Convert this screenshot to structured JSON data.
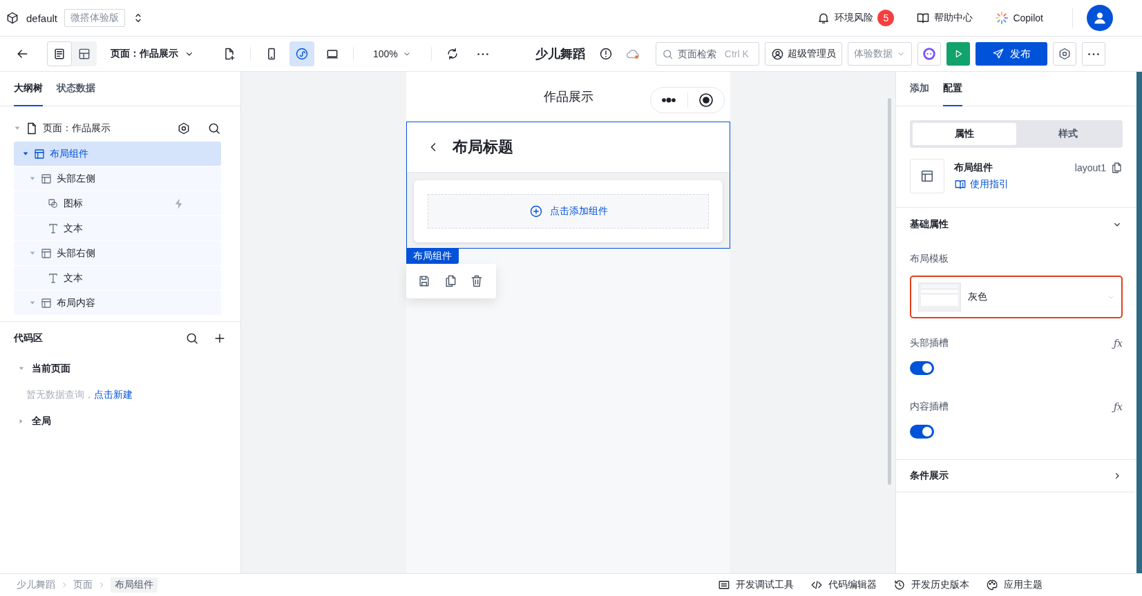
{
  "app_bar": {
    "workspace": "default",
    "edition": "微搭体验版",
    "risk": {
      "label": "环境风险",
      "count": "5"
    },
    "help": "帮助中心",
    "copilot": "Copilot"
  },
  "toolbar": {
    "view_modes": [
      {
        "kind": "outline",
        "selected": true
      },
      {
        "kind": "layout",
        "selected": false
      }
    ],
    "page_select": "页面：作品展示",
    "device_modes": [
      {
        "kind": "mobile",
        "selected": false
      },
      {
        "kind": "miniprogram",
        "selected": true
      },
      {
        "kind": "desktop",
        "selected": false
      }
    ],
    "zoom": "100%",
    "app_name": "少儿舞蹈",
    "search": {
      "placeholder": "页面检索",
      "shortcut": "Ctrl K"
    },
    "role": "超级管理员",
    "data_select": "体验数据",
    "publish": "发布"
  },
  "left_panel": {
    "tabs": [
      {
        "label": "大纲树",
        "selected": true
      },
      {
        "label": "状态数据",
        "selected": false
      }
    ],
    "tree": {
      "label": "页面：作品展示",
      "expanded": true,
      "children": [
        {
          "label": "布局组件",
          "kind": "layout",
          "selected": true,
          "expanded": true,
          "children": [
            {
              "label": "头部左侧",
              "kind": "layout",
              "selected": false,
              "expanded": true,
              "children": [
                {
                  "label": "图标",
                  "kind": "icon",
                  "selected": false,
                  "has_event": true
                },
                {
                  "label": "文本",
                  "kind": "text",
                  "selected": false,
                  "has_event": false
                }
              ]
            },
            {
              "label": "头部右侧",
              "kind": "layout",
              "selected": false,
              "expanded": true,
              "children": [
                {
                  "label": "文本",
                  "kind": "text",
                  "selected": false,
                  "has_event": false
                }
              ]
            },
            {
              "label": "布局内容",
              "kind": "layout",
              "selected": false,
              "expanded": true
            }
          ]
        }
      ]
    },
    "code_area": {
      "title": "代码区",
      "groups": [
        {
          "label": "当前页面",
          "expanded": true,
          "empty_text": "暂无数据查询，",
          "create_link": "点击新建"
        },
        {
          "label": "全局",
          "expanded": false
        }
      ]
    }
  },
  "canvas": {
    "page_title": "作品展示",
    "layout_title": "布局标题",
    "add_hint": "点击添加组件",
    "selection_label": "布局组件"
  },
  "right_panel": {
    "tabs": [
      {
        "label": "添加",
        "selected": false
      },
      {
        "label": "配置",
        "selected": true
      }
    ],
    "segments": [
      {
        "label": "属性",
        "selected": true
      },
      {
        "label": "样式",
        "selected": false
      }
    ],
    "component": {
      "name": "布局组件",
      "id": "layout1",
      "guide": "使用指引"
    },
    "basic_section": {
      "title": "基础属性",
      "expanded": true,
      "fields": [
        {
          "kind": "select",
          "label": "布局模板",
          "value": "灰色"
        },
        {
          "kind": "switch",
          "label": "头部插槽",
          "formula": "ƒx",
          "on": true
        },
        {
          "kind": "switch",
          "label": "内容插槽",
          "formula": "ƒx",
          "on": true
        }
      ]
    },
    "condition_section": {
      "title": "条件展示",
      "expanded": false
    }
  },
  "status_bar": {
    "breadcrumb": [
      "少儿舞蹈",
      "页面",
      "布局组件"
    ],
    "tools": [
      {
        "kind": "debug",
        "label": "开发调试工具"
      },
      {
        "kind": "code",
        "label": "代码编辑器"
      },
      {
        "kind": "history",
        "label": "开发历史版本"
      },
      {
        "kind": "theme",
        "label": "应用主题"
      }
    ]
  }
}
